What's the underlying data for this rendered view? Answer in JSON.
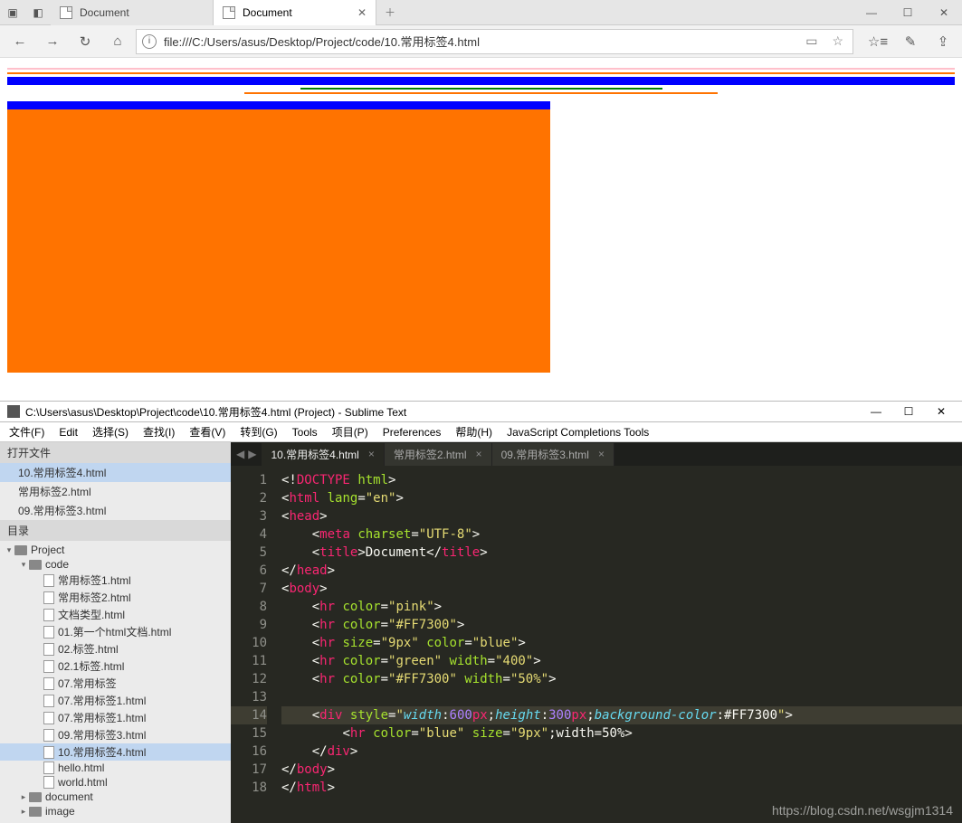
{
  "browser": {
    "tabs": [
      {
        "title": "Document",
        "active": false
      },
      {
        "title": "Document",
        "active": true
      }
    ],
    "url": "file:///C:/Users/asus/Desktop/Project/code/10.常用标签4.html"
  },
  "sublime": {
    "title": "C:\\Users\\asus\\Desktop\\Project\\code\\10.常用标签4.html (Project) - Sublime Text",
    "menu": [
      "文件(F)",
      "Edit",
      "选择(S)",
      "查找(I)",
      "查看(V)",
      "转到(G)",
      "Tools",
      "项目(P)",
      "Preferences",
      "帮助(H)",
      "JavaScript Completions Tools"
    ],
    "open_files_header": "打开文件",
    "open_files": [
      "10.常用标签4.html",
      "常用标签2.html",
      "09.常用标签3.html"
    ],
    "dir_header": "目录",
    "tree": {
      "root": "Project",
      "folder": "code",
      "files": [
        "常用标签1.html",
        "常用标签2.html",
        "文档类型.html",
        "01.第一个html文档.html",
        "02.标签.html",
        "02.1标签.html",
        "07.常用标签",
        "07.常用标签1.html",
        "07.常用标签1.html",
        "09.常用标签3.html",
        "10.常用标签4.html",
        "hello.html",
        "world.html"
      ],
      "selected_index": 10,
      "siblings": [
        "document",
        "image"
      ]
    },
    "editor_tabs": [
      {
        "title": "10.常用标签4.html",
        "active": true
      },
      {
        "title": "常用标签2.html",
        "active": false
      },
      {
        "title": "09.常用标签3.html",
        "active": false
      }
    ],
    "highlighted_line": 14,
    "code_lines": [
      {
        "n": 1,
        "html": "<span class='c-white'>&lt;!</span><span class='c-red'>DOCTYPE</span> <span class='c-green'>html</span><span class='c-white'>&gt;</span>"
      },
      {
        "n": 2,
        "html": "<span class='c-white'>&lt;</span><span class='c-red'>html</span> <span class='c-green'>lang</span><span class='c-white'>=</span><span class='c-yellow'>\"en\"</span><span class='c-white'>&gt;</span>"
      },
      {
        "n": 3,
        "html": "<span class='c-white'>&lt;</span><span class='c-red'>head</span><span class='c-white'>&gt;</span>"
      },
      {
        "n": 4,
        "html": "    <span class='c-white'>&lt;</span><span class='c-red'>meta</span> <span class='c-green'>charset</span><span class='c-white'>=</span><span class='c-yellow'>\"UTF-8\"</span><span class='c-white'>&gt;</span>"
      },
      {
        "n": 5,
        "html": "    <span class='c-white'>&lt;</span><span class='c-red'>title</span><span class='c-white'>&gt;Document&lt;/</span><span class='c-red'>title</span><span class='c-white'>&gt;</span>"
      },
      {
        "n": 6,
        "html": "<span class='c-white'>&lt;/</span><span class='c-red'>head</span><span class='c-white'>&gt;</span>"
      },
      {
        "n": 7,
        "html": "<span class='c-white'>&lt;</span><span class='c-red'>body</span><span class='c-white'>&gt;</span>"
      },
      {
        "n": 8,
        "html": "    <span class='c-white'>&lt;</span><span class='c-red'>hr</span> <span class='c-green'>color</span><span class='c-white'>=</span><span class='c-yellow'>\"pink\"</span><span class='c-white'>&gt;</span>"
      },
      {
        "n": 9,
        "html": "    <span class='c-white'>&lt;</span><span class='c-red'>hr</span> <span class='c-green'>color</span><span class='c-white'>=</span><span class='c-yellow'>\"#FF7300\"</span><span class='c-white'>&gt;</span>"
      },
      {
        "n": 10,
        "html": "    <span class='c-white'>&lt;</span><span class='c-red'>hr</span> <span class='c-green'>size</span><span class='c-white'>=</span><span class='c-yellow'>\"9px\"</span> <span class='c-green'>color</span><span class='c-white'>=</span><span class='c-yellow'>\"blue\"</span><span class='c-white'>&gt;</span>"
      },
      {
        "n": 11,
        "html": "    <span class='c-white'>&lt;</span><span class='c-red'>hr</span> <span class='c-green'>color</span><span class='c-white'>=</span><span class='c-yellow'>\"green\"</span> <span class='c-green'>width</span><span class='c-white'>=</span><span class='c-yellow'>\"400\"</span><span class='c-white'>&gt;</span>"
      },
      {
        "n": 12,
        "html": "    <span class='c-white'>&lt;</span><span class='c-red'>hr</span> <span class='c-green'>color</span><span class='c-white'>=</span><span class='c-yellow'>\"#FF7300\"</span> <span class='c-green'>width</span><span class='c-white'>=</span><span class='c-yellow'>\"50%\"</span><span class='c-white'>&gt;</span>"
      },
      {
        "n": 13,
        "html": ""
      },
      {
        "n": 14,
        "html": "    <span class='c-white'>&lt;</span><span class='c-red'>div</span> <span class='c-green'>style</span><span class='c-white'>=</span><span class='c-yellow'>\"</span><span class='c-cyan'>width</span><span class='c-white'>:</span><span class='c-purple'>600</span><span class='c-red'>px</span><span class='c-white'>;</span><span class='c-cyan'>height</span><span class='c-white'>:</span><span class='c-purple'>300</span><span class='c-red'>px</span><span class='c-white'>;</span><span class='c-cyan'>background-color</span><span class='c-white'>:#FF7300</span><span class='c-yellow'>\"</span><span class='c-white'>&gt;</span>"
      },
      {
        "n": 15,
        "html": "        <span class='c-white'>&lt;</span><span class='c-red'>hr</span> <span class='c-green'>color</span><span class='c-white'>=</span><span class='c-yellow'>\"blue\"</span> <span class='c-green'>size</span><span class='c-white'>=</span><span class='c-yellow'>\"9px\"</span><span class='c-white'>;width=50%&gt;</span>"
      },
      {
        "n": 16,
        "html": "    <span class='c-white'>&lt;/</span><span class='c-red'>div</span><span class='c-white'>&gt;</span>"
      },
      {
        "n": 17,
        "html": "<span class='c-white'>&lt;/</span><span class='c-red'>body</span><span class='c-white'>&gt;</span>"
      },
      {
        "n": 18,
        "html": "<span class='c-white'>&lt;/</span><span class='c-red'>html</span><span class='c-white'>&gt;</span>"
      }
    ],
    "watermark": "https://blog.csdn.net/wsgjm1314"
  }
}
